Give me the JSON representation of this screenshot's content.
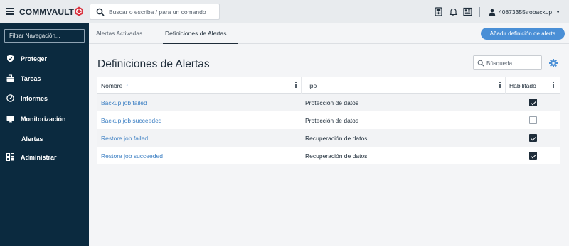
{
  "header": {
    "brand": "COMMVAULT",
    "search_placeholder": "Buscar o escriba / para un comando",
    "user": "40873355\\robackup",
    "user_caret": "▼"
  },
  "sidebar": {
    "filter_placeholder": "Filtrar Navegación...",
    "items": [
      {
        "label": "Proteger",
        "icon": "shield-icon"
      },
      {
        "label": "Tareas",
        "icon": "briefcase-icon"
      },
      {
        "label": "Informes",
        "icon": "gauge-icon"
      },
      {
        "label": "Monitorización",
        "icon": "monitor-icon"
      },
      {
        "label": "Alertas",
        "icon": ""
      },
      {
        "label": "Administrar",
        "icon": "grid-settings-icon"
      }
    ]
  },
  "tabs": [
    {
      "label": "Alertas Activadas"
    },
    {
      "label": "Definiciones de Alertas"
    }
  ],
  "add_button": "Añadir definición de alerta",
  "page_title": "Definiciones de Alertas",
  "table_search_placeholder": "Búsqueda",
  "table": {
    "columns": [
      {
        "label": "Nombre",
        "sort": "↑"
      },
      {
        "label": "Tipo"
      },
      {
        "label": "Habilitado"
      }
    ],
    "rows": [
      {
        "name": "Backup job failed",
        "type": "Protección de datos",
        "enabled": true
      },
      {
        "name": "Backup job succeeded",
        "type": "Protección de datos",
        "enabled": false
      },
      {
        "name": "Restore job failed",
        "type": "Recuperación de datos",
        "enabled": true
      },
      {
        "name": "Restore job succeeded",
        "type": "Recuperación de datos",
        "enabled": true
      }
    ]
  },
  "colors": {
    "sidebar_bg": "#0b2a3f",
    "accent": "#4a8fd6",
    "link": "#3c7fc3",
    "brand_mark": "#d9333f"
  }
}
